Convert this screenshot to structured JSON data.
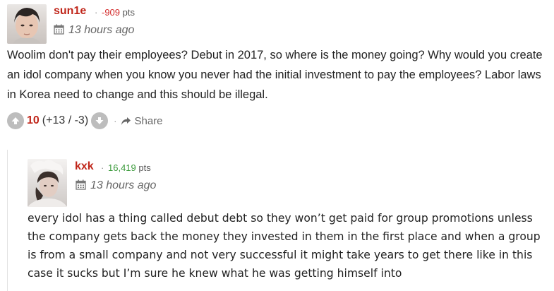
{
  "comments": [
    {
      "username": "sun1e",
      "points_value": "-909",
      "points_suffix": "pts",
      "time": "13 hours ago",
      "body": "Woolim don't pay their employees? Debut in 2017, so where is the money going? Why would you create an idol company when you know you never had the initial investment to pay the employees? Labor laws in Korea need to change and this should be illegal.",
      "score": "10",
      "breakdown": "(+13 / -3)",
      "share_label": "Share"
    },
    {
      "username": "kxk",
      "points_value": "16,419",
      "points_suffix": "pts",
      "time": "13 hours ago",
      "body": "every idol has a thing called debut debt so they won’t get paid for group promotions unless the company gets back the money they invested in them in the first place and when a group is from a small company and not very successful it might take years to get there like in this case it sucks but I’m sure he knew what he was getting himself into"
    }
  ],
  "colors": {
    "username": "#c0261a",
    "negative_points": "#d32b2b",
    "positive_points": "#3a9a3a",
    "vote_button": "#bdbdbd"
  },
  "icons": [
    "calendar-icon",
    "upvote-icon",
    "downvote-icon",
    "share-icon"
  ]
}
